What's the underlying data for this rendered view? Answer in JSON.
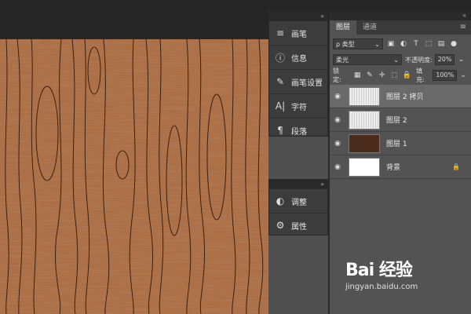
{
  "panels": {
    "collapsed_top": {
      "items": [
        {
          "label": "画笔",
          "icon": "brushes-icon"
        },
        {
          "label": "信息",
          "icon": "info-icon"
        },
        {
          "label": "画笔设置",
          "icon": "brush-settings-icon"
        },
        {
          "label": "字符",
          "icon": "character-icon"
        },
        {
          "label": "段落",
          "icon": "paragraph-icon"
        }
      ]
    },
    "collapsed_bottom": {
      "items": [
        {
          "label": "调整",
          "icon": "adjustments-icon"
        },
        {
          "label": "属性",
          "icon": "properties-icon"
        }
      ]
    }
  },
  "layers_panel": {
    "tabs": [
      "图层",
      "通道"
    ],
    "filter_label": "ρ 类型",
    "blend_mode": "柔光",
    "opacity_label": "不透明度:",
    "opacity_value": "20%",
    "lock_label": "锁定:",
    "fill_label": "填充:",
    "fill_value": "100%",
    "layers": [
      {
        "name": "图层 2 拷贝",
        "selected": true,
        "thumb": "noise"
      },
      {
        "name": "图层 2",
        "selected": false,
        "thumb": "noise"
      },
      {
        "name": "图层 1",
        "selected": false,
        "thumb": "#4a2b1c"
      },
      {
        "name": "背景",
        "selected": false,
        "thumb": "#ffffff",
        "locked": true
      }
    ]
  },
  "watermark": {
    "brand": "Bai 经验",
    "url": "jingyan.baidu.com"
  },
  "colors": {
    "wood": "#a5673f",
    "panel": "#535353",
    "selected": "#6a6a6a"
  }
}
